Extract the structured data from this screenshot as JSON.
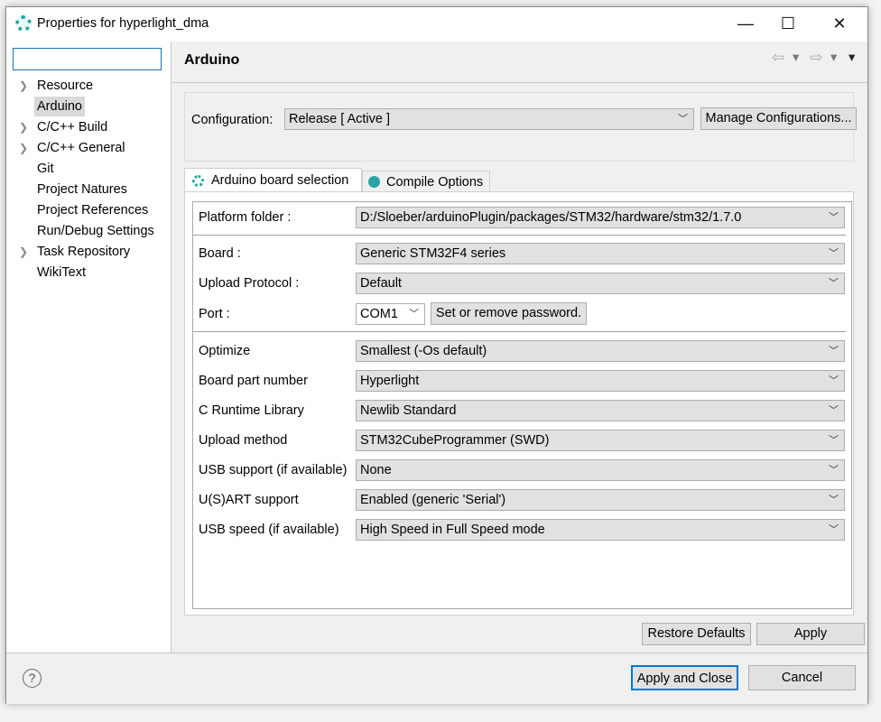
{
  "window": {
    "title": "Properties for hyperlight_dma",
    "minimize": "—",
    "maximize": "☐",
    "close": "✕"
  },
  "search": {
    "value": "",
    "placeholder": ""
  },
  "tree": [
    {
      "label": "Resource",
      "expandable": true
    },
    {
      "label": "Arduino",
      "expandable": false,
      "selected": true
    },
    {
      "label": "C/C++ Build",
      "expandable": true
    },
    {
      "label": "C/C++ General",
      "expandable": true
    },
    {
      "label": "Git",
      "expandable": false
    },
    {
      "label": "Project Natures",
      "expandable": false
    },
    {
      "label": "Project References",
      "expandable": false
    },
    {
      "label": "Run/Debug Settings",
      "expandable": false
    },
    {
      "label": "Task Repository",
      "expandable": true
    },
    {
      "label": "WikiText",
      "expandable": false
    }
  ],
  "page": {
    "title": "Arduino",
    "nav": {
      "back": "⇦",
      "forward": "⇨",
      "menu": "▾"
    }
  },
  "configuration": {
    "label": "Configuration:",
    "value": "Release  [ Active ]",
    "manage": "Manage Configurations..."
  },
  "tabs": [
    {
      "label": "Arduino board selection",
      "active": true
    },
    {
      "label": "Compile Options",
      "active": false
    }
  ],
  "fields": {
    "platform": {
      "label": "Platform folder :",
      "value": "D:/Sloeber/arduinoPlugin/packages/STM32/hardware/stm32/1.7.0"
    },
    "board": {
      "label": "Board :",
      "value": "Generic STM32F4 series"
    },
    "upload_protocol": {
      "label": "Upload Protocol :",
      "value": "Default"
    },
    "port": {
      "label": "Port :",
      "value": "COM1",
      "password_button": "Set or remove password."
    },
    "options": [
      {
        "label": "Optimize",
        "value": "Smallest (-Os default)"
      },
      {
        "label": "Board part number",
        "value": "Hyperlight"
      },
      {
        "label": "C Runtime Library",
        "value": "Newlib Standard"
      },
      {
        "label": "Upload method",
        "value": "STM32CubeProgrammer (SWD)"
      },
      {
        "label": "USB support (if available)",
        "value": "None"
      },
      {
        "label": "U(S)ART support",
        "value": "Enabled (generic 'Serial')"
      },
      {
        "label": "USB speed (if available)",
        "value": "High Speed in Full Speed mode"
      }
    ]
  },
  "buttons": {
    "restore": "Restore Defaults",
    "apply": "Apply",
    "apply_close": "Apply and Close",
    "cancel": "Cancel",
    "help": "?"
  },
  "colors": {
    "accent": "#0078d7",
    "icon": "#2aa3a3"
  }
}
